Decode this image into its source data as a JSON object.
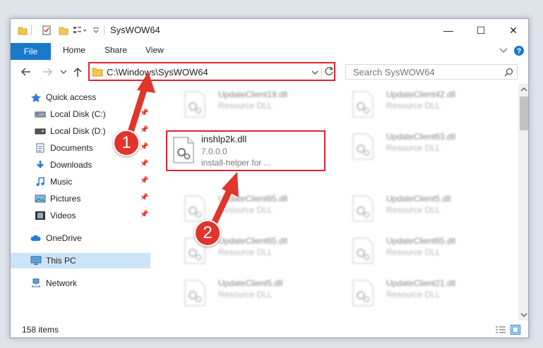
{
  "window": {
    "title": "SysWOW64",
    "minimize": "—",
    "maximize": "☐",
    "close": "✕"
  },
  "ribbon": {
    "tabs": [
      "File",
      "Home",
      "Share",
      "View"
    ]
  },
  "address": {
    "path": "C:\\Windows\\SysWOW64"
  },
  "search": {
    "placeholder": "Search SysWOW64"
  },
  "sidebar": {
    "items": [
      {
        "label": "Quick access",
        "icon": "star-icon"
      },
      {
        "label": "Local Disk (C:)",
        "icon": "drive-icon"
      },
      {
        "label": "Local Disk (D:)",
        "icon": "drive-icon"
      },
      {
        "label": "Documents",
        "icon": "documents-icon"
      },
      {
        "label": "Downloads",
        "icon": "downloads-icon"
      },
      {
        "label": "Music",
        "icon": "music-icon"
      },
      {
        "label": "Pictures",
        "icon": "pictures-icon"
      },
      {
        "label": "Videos",
        "icon": "videos-icon"
      },
      {
        "label": "OneDrive",
        "icon": "cloud-icon"
      },
      {
        "label": "This PC",
        "icon": "computer-icon"
      },
      {
        "label": "Network",
        "icon": "network-icon"
      }
    ]
  },
  "files": {
    "left": [
      {
        "name": "UpdateClient19.dll",
        "type": "Resource DLL"
      },
      {
        "name": "UpdateClient65.dll",
        "type": "Resource DLL"
      },
      {
        "name": "UpdateClient65.dll",
        "type": "Resource DLL"
      },
      {
        "name": "UpdateClient5.dll",
        "type": "Resource DLL"
      }
    ],
    "right": [
      {
        "name": "UpdateClient42.dll",
        "type": "Resource DLL"
      },
      {
        "name": "UpdateClient63.dll",
        "type": "Resource DLL"
      },
      {
        "name": "UpdateClient5.dll",
        "type": "Resource DLL"
      },
      {
        "name": "UpdateClient65.dll",
        "type": "Resource DLL"
      },
      {
        "name": "UpdateClient21.dll",
        "type": "Resource DLL"
      }
    ],
    "selected": {
      "name": "inshlp2k.dll",
      "version": "7.0.0.0",
      "description": "install-helper for ..."
    }
  },
  "status": {
    "count": "158 items"
  },
  "annotations": {
    "step1": "1",
    "step2": "2"
  },
  "colors": {
    "accent": "#1979ca",
    "highlight": "#e1242e",
    "badge": "#e1352b"
  }
}
